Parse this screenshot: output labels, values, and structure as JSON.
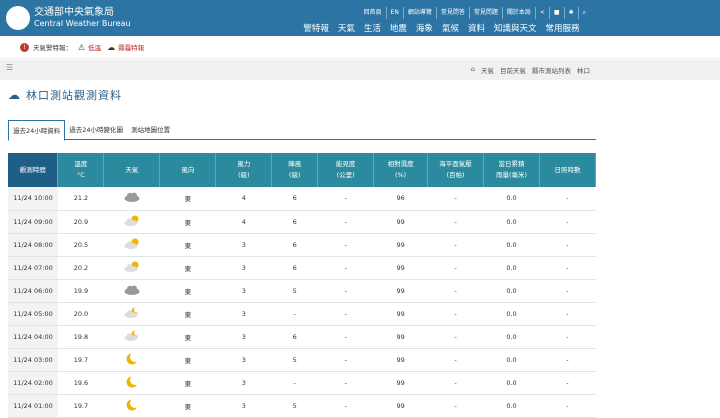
{
  "header": {
    "title": "交通部中央氣象局",
    "subtitle": "Central Weather Bureau",
    "top_links": [
      "回首頁",
      "EN",
      "網站導覽",
      "常見問答",
      "常見問題",
      "關於本局"
    ],
    "nav": [
      "警特報",
      "天氣",
      "生活",
      "地震",
      "海象",
      "氣候",
      "資料",
      "知識與天文",
      "常用服務"
    ]
  },
  "warnings": {
    "label": "天氣警特報：",
    "items": [
      "低溫",
      "霧霾特報"
    ]
  },
  "breadcrumb": [
    "天氣",
    "目前天氣",
    "縣市測站列表",
    "林口"
  ],
  "page": {
    "title": "林口測站觀測資料"
  },
  "tabs": [
    "過去24小時資料",
    "過去24小時變化圖",
    "測站地圖位置"
  ],
  "table": {
    "headers": [
      "觀測時間",
      "溫度\n°C",
      "天氣",
      "風向",
      "風力\n(級)",
      "陣風\n(級)",
      "能見度\n(公里)",
      "相對濕度\n(%)",
      "海平面氣壓\n(百帕)",
      "當日累積\n雨量(毫米)",
      "日照時數"
    ],
    "rows": [
      {
        "time": "11/24 10:00",
        "temp": "21.2",
        "wx": "cloudy",
        "dir": "東",
        "wind": "4",
        "gust": "6",
        "vis": "-",
        "rh": "96",
        "press": "-",
        "rain": "0.0",
        "sun": "-"
      },
      {
        "time": "11/24 09:00",
        "temp": "20.9",
        "wx": "partly-cloudy",
        "dir": "東",
        "wind": "4",
        "gust": "6",
        "vis": "-",
        "rh": "99",
        "press": "-",
        "rain": "0.0",
        "sun": "-"
      },
      {
        "time": "11/24 08:00",
        "temp": "20.5",
        "wx": "partly-cloudy",
        "dir": "東",
        "wind": "3",
        "gust": "6",
        "vis": "-",
        "rh": "99",
        "press": "-",
        "rain": "0.0",
        "sun": "-"
      },
      {
        "time": "11/24 07:00",
        "temp": "20.2",
        "wx": "partly-cloudy",
        "dir": "東",
        "wind": "3",
        "gust": "6",
        "vis": "-",
        "rh": "99",
        "press": "-",
        "rain": "0.0",
        "sun": "-"
      },
      {
        "time": "11/24 06:00",
        "temp": "19.9",
        "wx": "cloudy",
        "dir": "東",
        "wind": "3",
        "gust": "5",
        "vis": "-",
        "rh": "99",
        "press": "-",
        "rain": "0.0",
        "sun": "-"
      },
      {
        "time": "11/24 05:00",
        "temp": "20.0",
        "wx": "partly-cloudy-night",
        "dir": "東",
        "wind": "3",
        "gust": "-",
        "vis": "-",
        "rh": "99",
        "press": "-",
        "rain": "0.0",
        "sun": "-"
      },
      {
        "time": "11/24 04:00",
        "temp": "19.8",
        "wx": "partly-cloudy-night",
        "dir": "東",
        "wind": "3",
        "gust": "6",
        "vis": "-",
        "rh": "99",
        "press": "-",
        "rain": "0.0",
        "sun": "-"
      },
      {
        "time": "11/24 03:00",
        "temp": "19.7",
        "wx": "moon",
        "dir": "東",
        "wind": "3",
        "gust": "5",
        "vis": "-",
        "rh": "99",
        "press": "-",
        "rain": "0.0",
        "sun": "-"
      },
      {
        "time": "11/24 02:00",
        "temp": "19.6",
        "wx": "moon",
        "dir": "東",
        "wind": "3",
        "gust": "-",
        "vis": "-",
        "rh": "99",
        "press": "-",
        "rain": "0.0",
        "sun": "-"
      },
      {
        "time": "11/24 01:00",
        "temp": "19.7",
        "wx": "moon",
        "dir": "東",
        "wind": "3",
        "gust": "5",
        "vis": "-",
        "rh": "99",
        "press": "-",
        "rain": "0.0",
        "sun": "-"
      }
    ]
  }
}
